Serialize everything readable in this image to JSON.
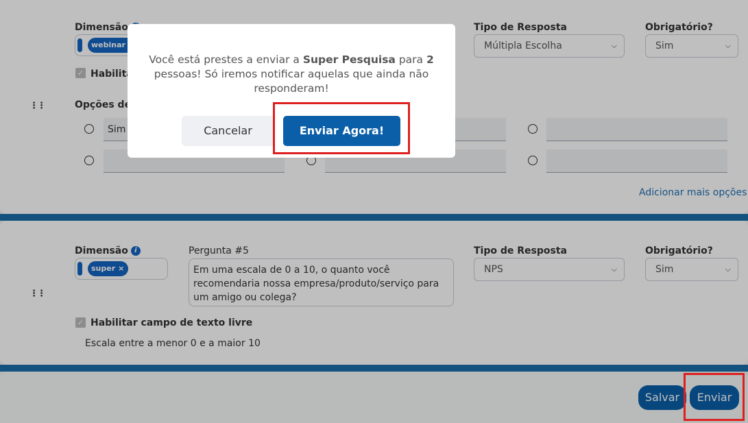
{
  "question_top": {
    "dimension_label": "Dimensão",
    "dimension_tag": "webinar",
    "tag_remove": "×",
    "response_type_label": "Tipo de Resposta",
    "response_type_value": "Múltipla Escolha",
    "required_label": "Obrigatório?",
    "required_value": "Sim",
    "enable_free_text_label": "Habilita",
    "options_label": "Opções de R",
    "options": [
      "Sim",
      "",
      "",
      "",
      "",
      ""
    ],
    "add_more_options": "Adicionar mais opções"
  },
  "question_5": {
    "dimension_label": "Dimensão",
    "info_glyph": "i",
    "dimension_tag": "super",
    "tag_remove": "×",
    "question_label": "Pergunta #5",
    "question_text": "Em uma escala de 0 a 10, o quanto você recomendaria nossa empresa/produto/serviço para um amigo ou colega?",
    "response_type_label": "Tipo de Resposta",
    "response_type_value": "NPS",
    "required_label": "Obrigatório?",
    "required_value": "Sim",
    "enable_free_text_label": "Habilitar campo de texto livre",
    "scale_text": "Escala entre a menor 0 e a maior 10"
  },
  "footer": {
    "save_label": "Salvar",
    "send_label": "Enviar"
  },
  "modal": {
    "msg_part1": "Você está prestes a enviar a ",
    "survey_name": "Super Pesquisa",
    "msg_part2": " para ",
    "count": "2",
    "msg_part3": " pessoas! Só iremos notificar aquelas que ainda não responderam!",
    "cancel_label": "Cancelar",
    "send_now_label": "Enviar Agora!"
  },
  "colors": {
    "primary": "#0a5fa8",
    "highlight": "#dd1f1f",
    "divider": "#1a6ea8"
  },
  "icons": {
    "drag": "drag-handle-icon",
    "check": "check-icon",
    "chevron": "chevron-down-icon",
    "info": "info-icon"
  }
}
